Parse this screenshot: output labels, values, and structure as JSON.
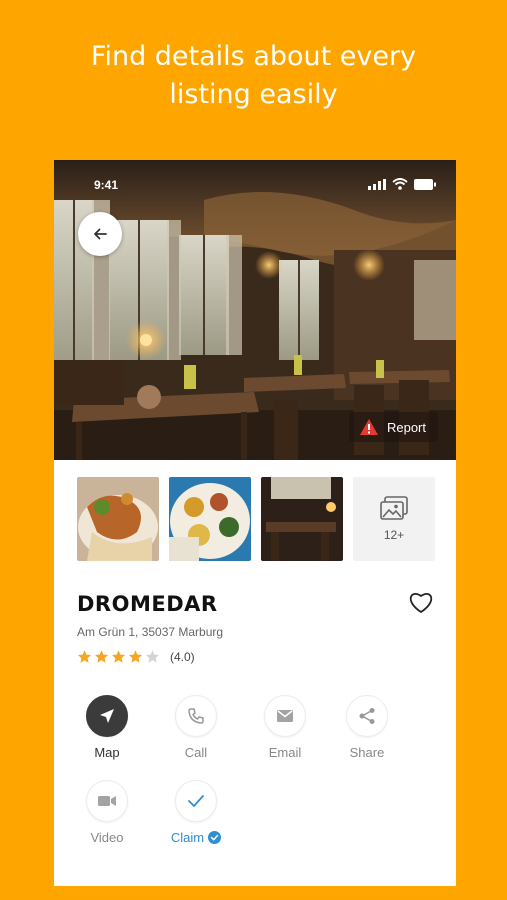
{
  "headline": {
    "line1": "Find details about every",
    "line2": "listing easily"
  },
  "status_bar": {
    "time": "9:41"
  },
  "hero": {
    "report_label": "Report"
  },
  "gallery": {
    "more_count": "12+"
  },
  "listing": {
    "name": "DROMEDAR",
    "address": "Am Grün 1, 35037 Marburg",
    "rating_stars": 4,
    "rating_text": "(4.0)"
  },
  "actions": {
    "map": "Map",
    "call": "Call",
    "email": "Email",
    "share": "Share",
    "video": "Video",
    "claim": "Claim"
  },
  "colors": {
    "background": "#FFA500",
    "star": "#F5A623",
    "claim_blue": "#2F8FCF",
    "report_red": "#E53935"
  }
}
